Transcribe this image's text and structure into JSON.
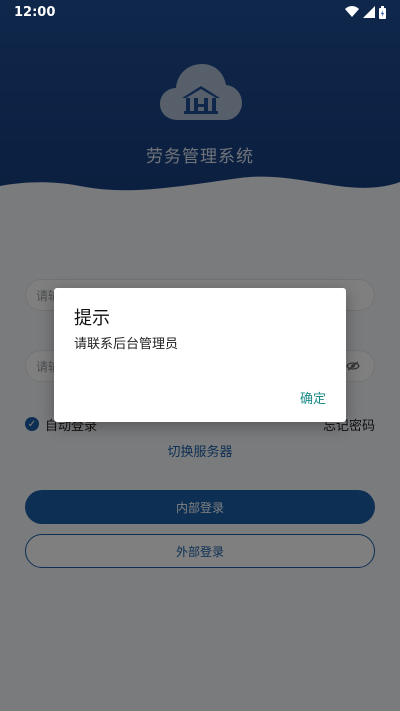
{
  "status_bar": {
    "time": "12:00"
  },
  "app": {
    "title": "劳务管理系统",
    "logo_glyph": "iconfont-building-logo"
  },
  "form": {
    "username_placeholder": "请输",
    "password_placeholder": "请输",
    "auto_login_label": "自动登录",
    "forgot_password_label": "忘记密码",
    "switch_server_label": "切换服务器",
    "internal_login_label": "内部登录",
    "external_login_label": "外部登录"
  },
  "dialog": {
    "title": "提示",
    "message": "请联系后台管理员",
    "ok_label": "确定"
  },
  "colors": {
    "brand_blue": "#1b5ea8",
    "header_blue": "#173f80",
    "dialog_accent": "#1a8a88"
  }
}
